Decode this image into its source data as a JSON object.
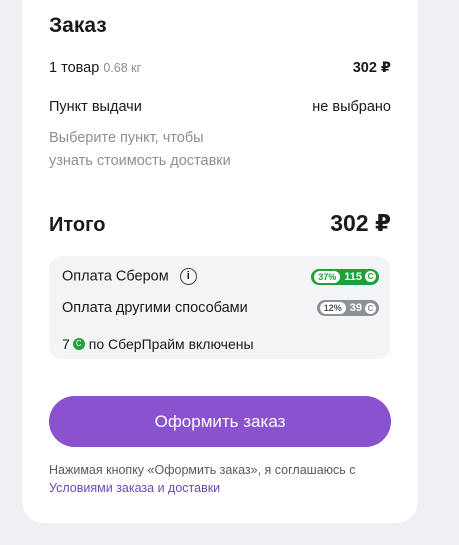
{
  "order": {
    "title": "Заказ",
    "items_label": "1 товар",
    "weight": "0.68 кг",
    "items_price": "302 ₽",
    "pickup_label": "Пункт выдачи",
    "pickup_value": "не выбрано",
    "pickup_hint_line1": "Выберите пункт, чтобы",
    "pickup_hint_line2": "узнать стоимость доставки"
  },
  "total": {
    "label": "Итого",
    "amount": "302 ₽"
  },
  "payment": {
    "sber": {
      "label": "Оплата Сбером",
      "info_glyph": "i",
      "percent": "37%",
      "bonus": "115"
    },
    "other": {
      "label": "Оплата другими способами",
      "percent": "12%",
      "bonus": "39"
    },
    "prime": {
      "count": "7",
      "text": "по СберПрайм включены"
    },
    "coin_glyph": "С"
  },
  "checkout": {
    "button_label": "Оформить заказ"
  },
  "legal": {
    "text": "Нажимая кнопку «Оформить заказ», я соглашаюсь с ",
    "link": "Условиями заказа и доставки"
  },
  "colors": {
    "accent": "#8a52cf",
    "bonus_green": "#21a038",
    "bonus_gray": "#8d9199"
  }
}
